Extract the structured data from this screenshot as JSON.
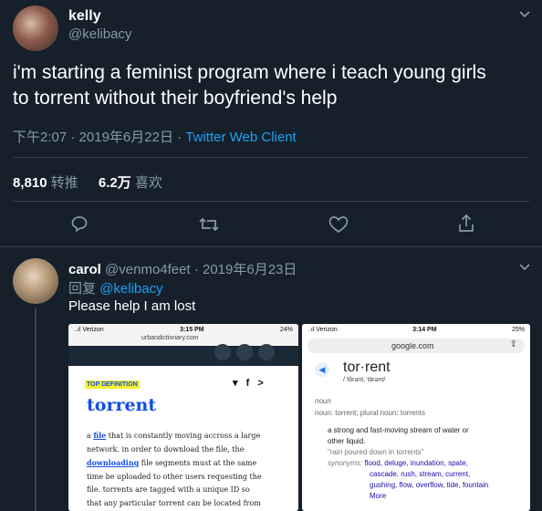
{
  "tweet": {
    "display_name": "kelly",
    "handle": "@kelibacy",
    "text_line1": "i'm starting a feminist program where i teach young girls",
    "text_line2": "to torrent without their boyfriend's help",
    "time": "下午2:07",
    "date": "2019年6月22日",
    "dot": "·",
    "client": "Twitter Web Client",
    "retweets_count": "8,810",
    "retweets_label": "转推",
    "likes_count": "6.2万",
    "likes_label": "喜欢"
  },
  "reply": {
    "display_name": "carol",
    "handle": "@venmo4feet",
    "dot": "·",
    "date": "2019年6月23日",
    "reply_to_label": "回复",
    "reply_to_handle": "@kelibacy",
    "text": "Please help I am lost"
  },
  "left_shot": {
    "carrier": "..ıl Verizon",
    "time": "3:15 PM",
    "battery": "24%",
    "url": "urbandictionary.com",
    "badge": "TOP DEFINITION",
    "word": "torrent",
    "def_line1_a": "a ",
    "def_line1_link": "file",
    "def_line1_b": " that is constantly moving accross a large",
    "def_line2": "network. in order to download the file, the",
    "def_line3_link": "downloading",
    "def_line3_b": " file segments must at the same",
    "def_line4": "time be uploaded to other users requesting the",
    "def_line5": "file. torrents are tagged with a unique ID so",
    "def_line6": "that any particular torrent can be located from"
  },
  "right_shot": {
    "carrier": "..ıl Verizon",
    "time": "3:14 PM",
    "battery": "25%",
    "url": "google.com",
    "word": "tor·rent",
    "pron": "/ˈtôrənt,ˈtärənt/",
    "pos": "noun",
    "forms": "noun: torrent; plural noun: torrents",
    "def1": "a strong and fast-moving stream of water or",
    "def2": "other liquid.",
    "example": "\"rain poured down in torrents\"",
    "syn_label": "synonyms:",
    "syn1": "flood, deluge, inundation, spate,",
    "syn2": "cascade, rush, stream, current,",
    "syn3": "gushing, flow, overflow, tide, fountain",
    "syn4": "More"
  },
  "colors": {
    "background": "#15202b",
    "muted": "#8899a6",
    "accent": "#1da1f2",
    "divider": "#38444d"
  },
  "icons": [
    "chevron-down-icon",
    "reply-icon",
    "retweet-icon",
    "like-icon",
    "share-icon"
  ]
}
